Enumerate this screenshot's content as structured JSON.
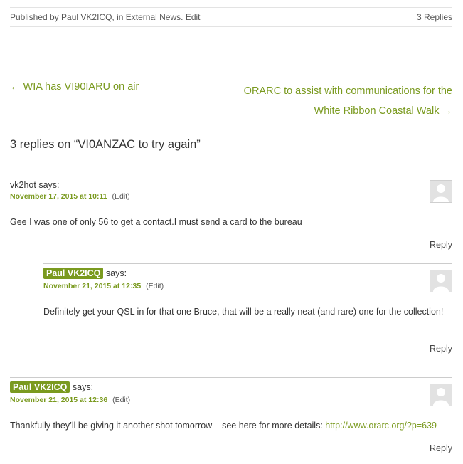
{
  "meta": {
    "published_prefix": "Published by ",
    "author": "Paul VK2ICQ",
    "in_text": ", in ",
    "category": "External News",
    "dot": ".",
    "edit": "Edit",
    "replies": "3 Replies"
  },
  "post_nav": {
    "prev": "← WIA has VI90IARU on air",
    "next_line1": "ORARC to assist with communications for the",
    "next_line2": "White Ribbon Coastal Walk →"
  },
  "comments_title": "3 replies on “VI0ANZAC to try again”",
  "comments": [
    {
      "author": "vk2hot",
      "says": " says:",
      "date": "November 17, 2015 at 10:11",
      "edit": "(Edit)",
      "text": "Gee I was one of only 56 to get a contact.I must send a card to the bureau",
      "reply": "Reply"
    },
    {
      "author": "Paul VK2ICQ",
      "says": " says:",
      "date": "November 21, 2015 at 12:35",
      "edit": "(Edit)",
      "text": "Definitely get your QSL in for that one Bruce, that will be a really neat (and rare) one for the collection!",
      "reply": "Reply"
    },
    {
      "author": "Paul VK2ICQ",
      "says": " says:",
      "date": "November 21, 2015 at 12:36",
      "edit": "(Edit)",
      "text": "Thankfully they’ll be giving it another shot tomorrow – see here for more details: ",
      "link": "http://www.orarc.org/?p=639",
      "reply": "Reply"
    }
  ],
  "colors": {
    "accent": "#7a9a1f",
    "text": "#333333",
    "divider": "#cccccc"
  },
  "icons": {
    "avatar": "default-avatar-icon"
  }
}
